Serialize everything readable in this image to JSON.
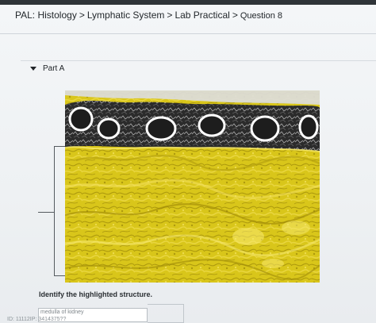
{
  "breadcrumb": {
    "items": [
      "PAL: Histology",
      "Lymphatic System",
      "Lab Practical",
      "Question 8"
    ],
    "separator": ">"
  },
  "part": {
    "label": "Part A",
    "icon": "caret-down-icon"
  },
  "image": {
    "highlight_color": "#d9c61a",
    "tissue_color": "#2b2b2b"
  },
  "question": {
    "prompt": "Identify the highlighted structure."
  },
  "answer": {
    "selected_value": "medulla of kidney",
    "id_text": "ID: 11112IP: 3414375??"
  }
}
